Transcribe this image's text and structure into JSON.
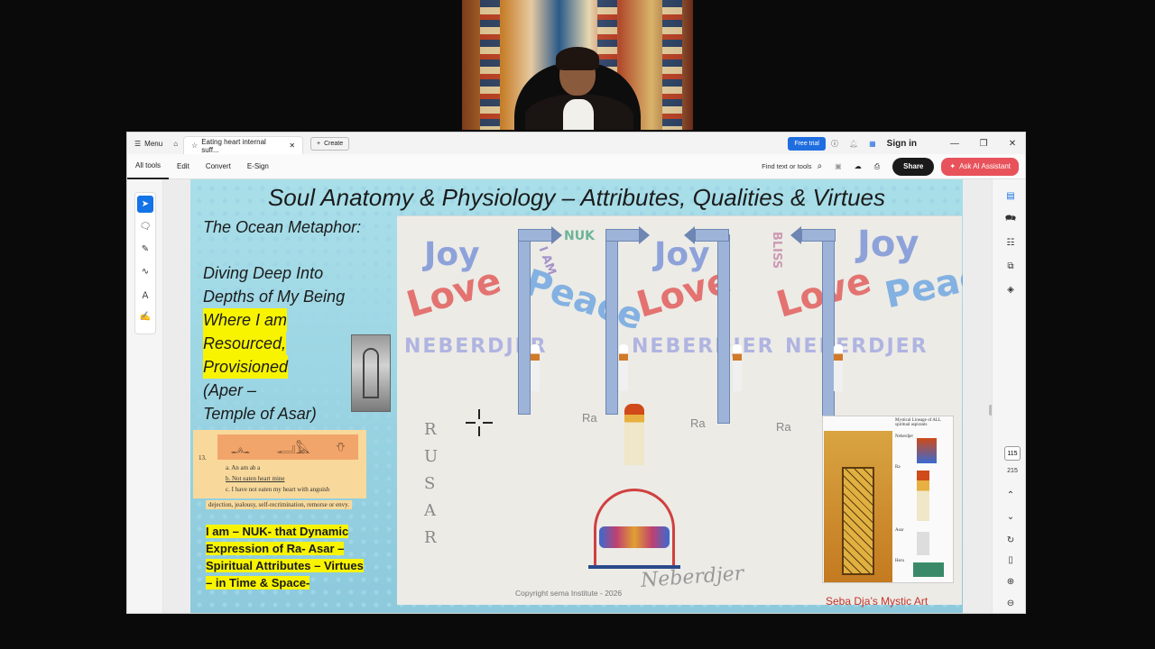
{
  "titlebar": {
    "menu_label": "Menu",
    "tab_title": "Eating heart internal suff...",
    "create_label": "Create",
    "free_trial_label": "Free trial",
    "sign_in_label": "Sign in"
  },
  "toolbar": {
    "tabs": [
      "All tools",
      "Edit",
      "Convert",
      "E-Sign"
    ],
    "find_label": "Find text or tools",
    "share_label": "Share",
    "ai_label": "Ask AI Assistant"
  },
  "slide": {
    "title": "Soul Anatomy & Physiology – Attributes, Qualities & Virtues",
    "ocean": "The Ocean Metaphor:",
    "diving_1": "Diving Deep Into",
    "diving_2": "Depths of My Being",
    "where": "Where I am",
    "resourced": "Resourced,",
    "provisioned": "Provisioned",
    "aper": "(Aper –",
    "temple": "Temple of Asar)",
    "hiero_num": "13.",
    "hiero_a": "a.   An            am                          ab    a",
    "hiero_b": "b.   Not           eaten                      heart mine",
    "hiero_c": "c.   I have not eaten my heart with anguish",
    "hiero_d": "dejection, jealousy, self-recrimination, remorse or envy.",
    "nuk_1": "I am – NUK- that Dynamic",
    "nuk_2": "Expression of Ra- Asar –",
    "nuk_3": "Spiritual Attributes – Virtues",
    "nuk_4": "– in Time & Space-",
    "copyright": "Copyright sema Institute - 2026",
    "credit": "Seba Dja’s Mystic Art",
    "art_words": {
      "joy": "Joy",
      "love": "Love",
      "peace": "Peace",
      "neberdjer": "NEBERDJER",
      "ra": "Ra",
      "rusar": "RUSAR",
      "nuk": "NUK",
      "iam": "I AM",
      "bliss": "BLISS",
      "neberdjer_script": "Neberdjer"
    },
    "panel_title": "Mystical Lineage of ALL spiritual aspirants",
    "panel_labels": [
      "Neberdjer",
      "Ra",
      "Asar",
      "Heru"
    ]
  },
  "right_rail": {
    "page_current": "115",
    "page_total": "215"
  },
  "colors": {
    "accent": "#1473e6",
    "highlight": "#f8f400",
    "credit": "#c2332b",
    "ai_button": "#e8525a"
  }
}
